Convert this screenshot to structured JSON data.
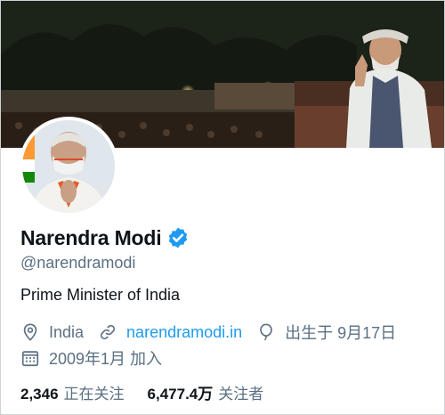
{
  "profile": {
    "display_name": "Narendra Modi",
    "handle": "@narendramodi",
    "bio": "Prime Minister of India",
    "location": "India",
    "website": "narendramodi.in",
    "birthday": "出生于 9月17日",
    "joined": "2009年1月 加入",
    "following_count": "2,346",
    "following_label": "正在关注",
    "followers_count": "6,477.4万",
    "followers_label": "关注者"
  },
  "icons": {
    "verified": "verified-badge-icon",
    "location": "map-pin-icon",
    "website": "link-icon",
    "birthday": "balloon-icon",
    "joined": "calendar-icon"
  },
  "colors": {
    "accent": "#1d9bf0",
    "secondary_text": "#5b7083",
    "primary_text": "#0f1419"
  }
}
